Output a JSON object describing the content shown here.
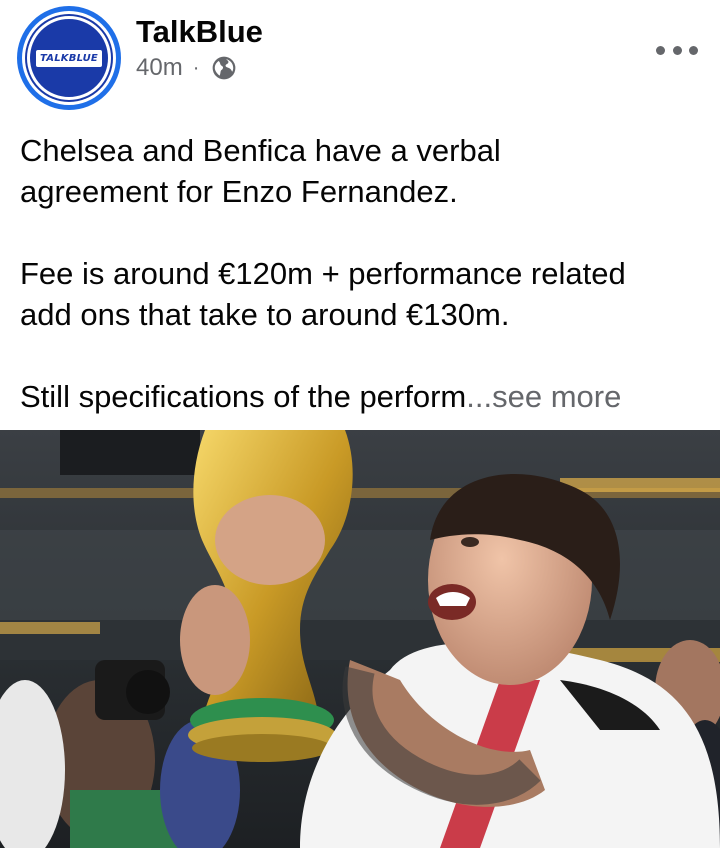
{
  "post": {
    "page_name": "TalkBlue",
    "avatar_text": "TALKBLUE",
    "time": "40m",
    "separator": "·",
    "privacy_icon": "globe-icon",
    "more_icon": "more-options-icon",
    "text": {
      "line1": "Chelsea and Benfica have a verbal",
      "line2": "agreement for Enzo Fernandez.",
      "line3": "Fee is around €120m + performance related",
      "line4": "add ons that take to around €130m.",
      "line5": "Still specifications of the perform",
      "ellipsis": "...",
      "see_more": "see more"
    }
  },
  "colors": {
    "brand_blue": "#1f6fe8",
    "text": "#050505",
    "muted": "#65676b"
  }
}
